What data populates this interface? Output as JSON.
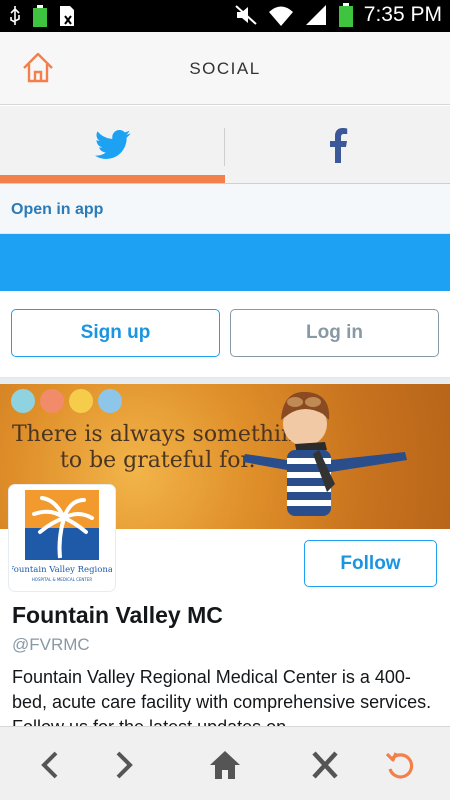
{
  "status_bar": {
    "time": "7:35 PM",
    "icons": [
      "usb-icon",
      "battery-full-icon",
      "sim-icon",
      "mute-icon",
      "wifi-icon",
      "signal-icon",
      "battery-icon"
    ]
  },
  "header": {
    "title": "SOCIAL",
    "home_icon": "home-icon",
    "accent_color": "#f3804b"
  },
  "tabs": [
    {
      "name": "Twitter",
      "icon": "twitter-icon",
      "selected": true,
      "color": "#1da1f2"
    },
    {
      "name": "Facebook",
      "icon": "facebook-icon",
      "selected": false,
      "color": "#3b5998"
    }
  ],
  "web": {
    "open_in_app": "Open in app",
    "signup_label": "Sign up",
    "login_label": "Log in",
    "banner": {
      "line1": "There is always something",
      "line2": "to be grateful for.",
      "dot_colors": [
        "#8fd3e0",
        "#f28b6a",
        "#f5cd4b",
        "#8ec6ea"
      ]
    },
    "profile": {
      "logo_text": "Fountain Valley Regional",
      "logo_subtext": "HOSPITAL & MEDICAL CENTER",
      "follow_label": "Follow",
      "name": "Fountain Valley MC",
      "handle": "@FVRMC",
      "bio": "Fountain Valley Regional Medical Center is a 400-bed, acute care facility with comprehensive services. Follow us for the latest updates on"
    }
  },
  "bottom_nav": {
    "items": [
      "back-icon",
      "forward-icon",
      "home-icon",
      "close-icon",
      "refresh-icon"
    ]
  }
}
